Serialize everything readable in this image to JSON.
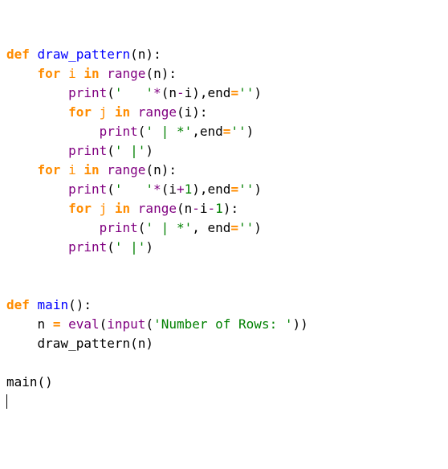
{
  "code": {
    "def": "def",
    "for": "for",
    "in": "in",
    "eq": "=",
    "fn_draw": "draw_pattern",
    "fn_main": "main",
    "print": "print",
    "range": "range",
    "eval": "eval",
    "input": "input",
    "n": "n",
    "i": "i",
    "j": "j",
    "end": "end",
    "star": "*",
    "minus": "-",
    "plus": "+",
    "lp": "(",
    "rp": ")",
    "colon": ":",
    "comma": ",",
    "s_sp3": "'   '",
    "s_empty": "''",
    "s_barstar": "' | *'",
    "s_bar": "' |'",
    "s_prompt": "'Number of Rows: '",
    "num1": "1",
    "call_draw": "draw_pattern(n)",
    "call_main": "main()"
  }
}
